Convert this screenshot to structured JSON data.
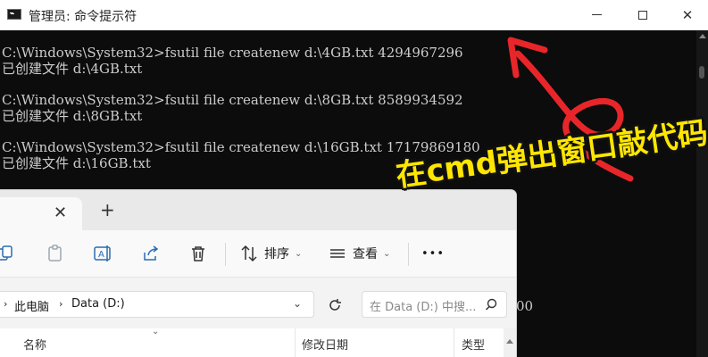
{
  "cmd": {
    "title": "管理员: 命令提示符",
    "lines": [
      "C:\\Windows\\System32>fsutil file createnew d:\\4GB.txt 4294967296",
      "已创建文件 d:\\4GB.txt",
      "",
      "C:\\Windows\\System32>fsutil file createnew d:\\8GB.txt 8589934592",
      "已创建文件 d:\\8GB.txt",
      "",
      "C:\\Windows\\System32>fsutil file createnew d:\\16GB.txt 17179869180",
      "已创建文件 d:\\16GB.txt"
    ],
    "stray_text": "00"
  },
  "annotation": {
    "caption": "在cmd弹出窗口敲代码",
    "text_color": "#ffe600",
    "arrow_color": "#e8262a"
  },
  "explorer": {
    "toolbar": {
      "sort_label": "排序",
      "view_label": "查看",
      "more_label": "•••"
    },
    "breadcrumb": [
      "此电脑",
      "Data (D:)"
    ],
    "search_placeholder": "在 Data (D:) 中搜...",
    "columns": [
      "名称",
      "修改日期",
      "类型"
    ]
  }
}
